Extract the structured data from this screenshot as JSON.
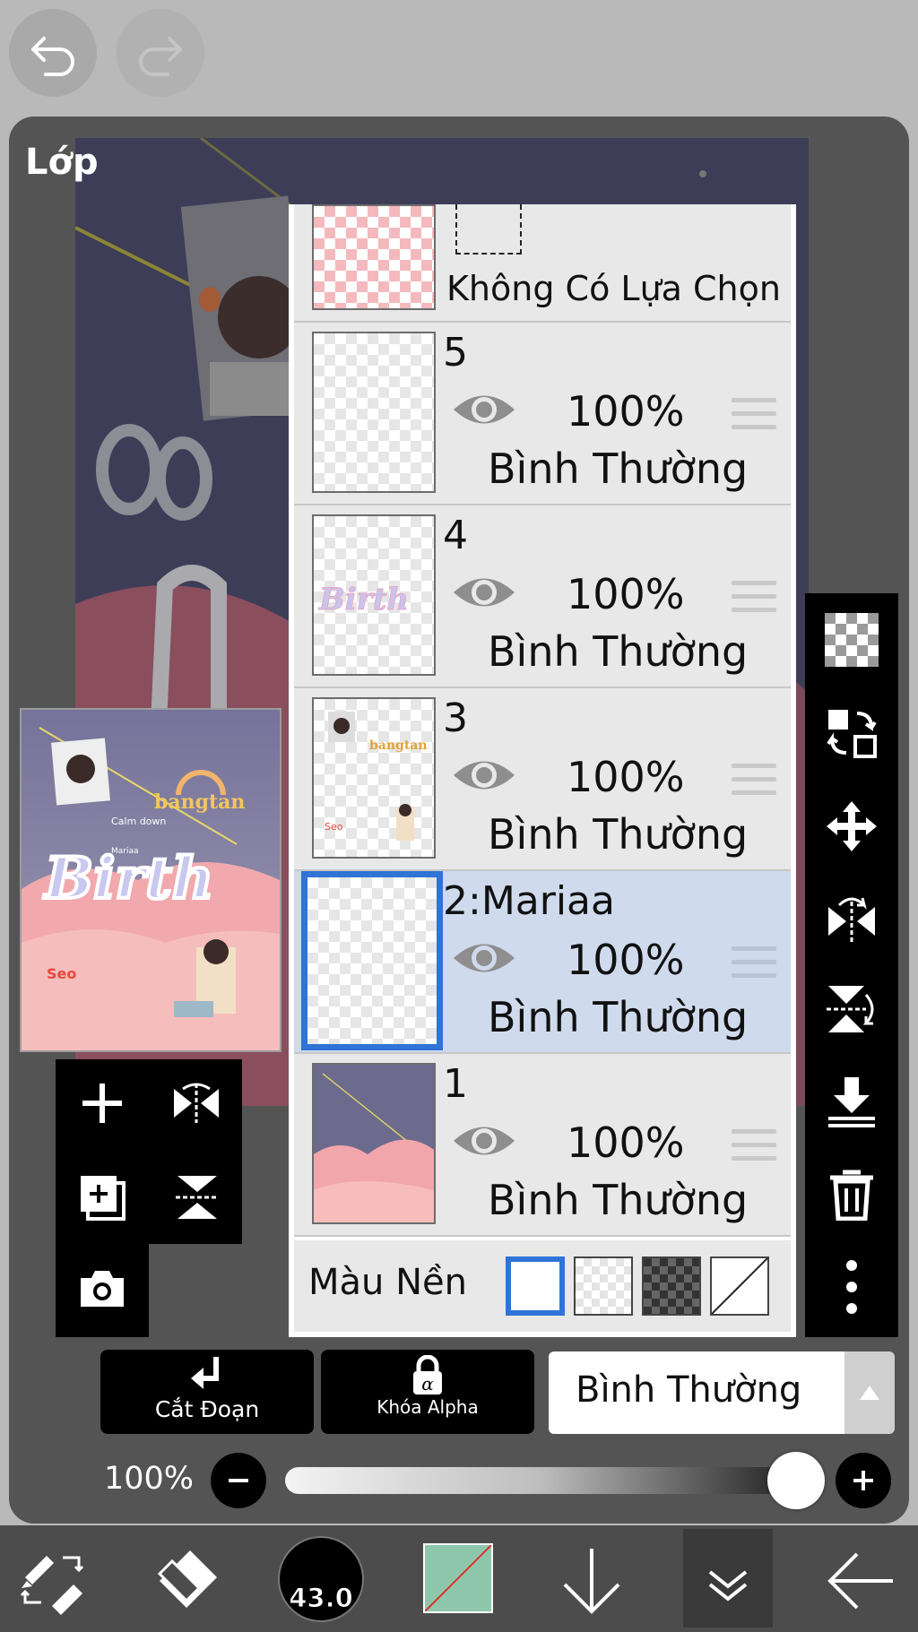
{
  "panel": {
    "title": "Lớp"
  },
  "selection_layer": {
    "label": "Không Có Lựa Chọn"
  },
  "layers": [
    {
      "name": "5",
      "opacity": "100%",
      "blend": "Bình Thường"
    },
    {
      "name": "4",
      "opacity": "100%",
      "blend": "Bình Thường"
    },
    {
      "name": "3",
      "opacity": "100%",
      "blend": "Bình Thường"
    },
    {
      "name": "2:Mariaa",
      "opacity": "100%",
      "blend": "Bình Thường",
      "selected": true
    },
    {
      "name": "1",
      "opacity": "100%",
      "blend": "Bình Thường"
    }
  ],
  "background_color": {
    "label": "Màu Nền",
    "options": [
      "white",
      "transparent-light",
      "transparent-dark",
      "none"
    ],
    "selected": "white"
  },
  "preview": {
    "words": [
      "bangtan",
      "Calm down",
      "Birth",
      "Mariaa",
      "Seo"
    ]
  },
  "controls": {
    "clipping_label": "Cắt Đoạn",
    "alpha_lock_label": "Khóa Alpha",
    "blend_mode": "Bình Thường",
    "opacity_label": "100%",
    "opacity_value": 1.0
  },
  "bottom_bar": {
    "brush_size": "43.0",
    "primary_color": "#8fc7ad"
  },
  "colors": {
    "selection_blue": "#2f74d6",
    "selected_row": "#cfdaed"
  }
}
